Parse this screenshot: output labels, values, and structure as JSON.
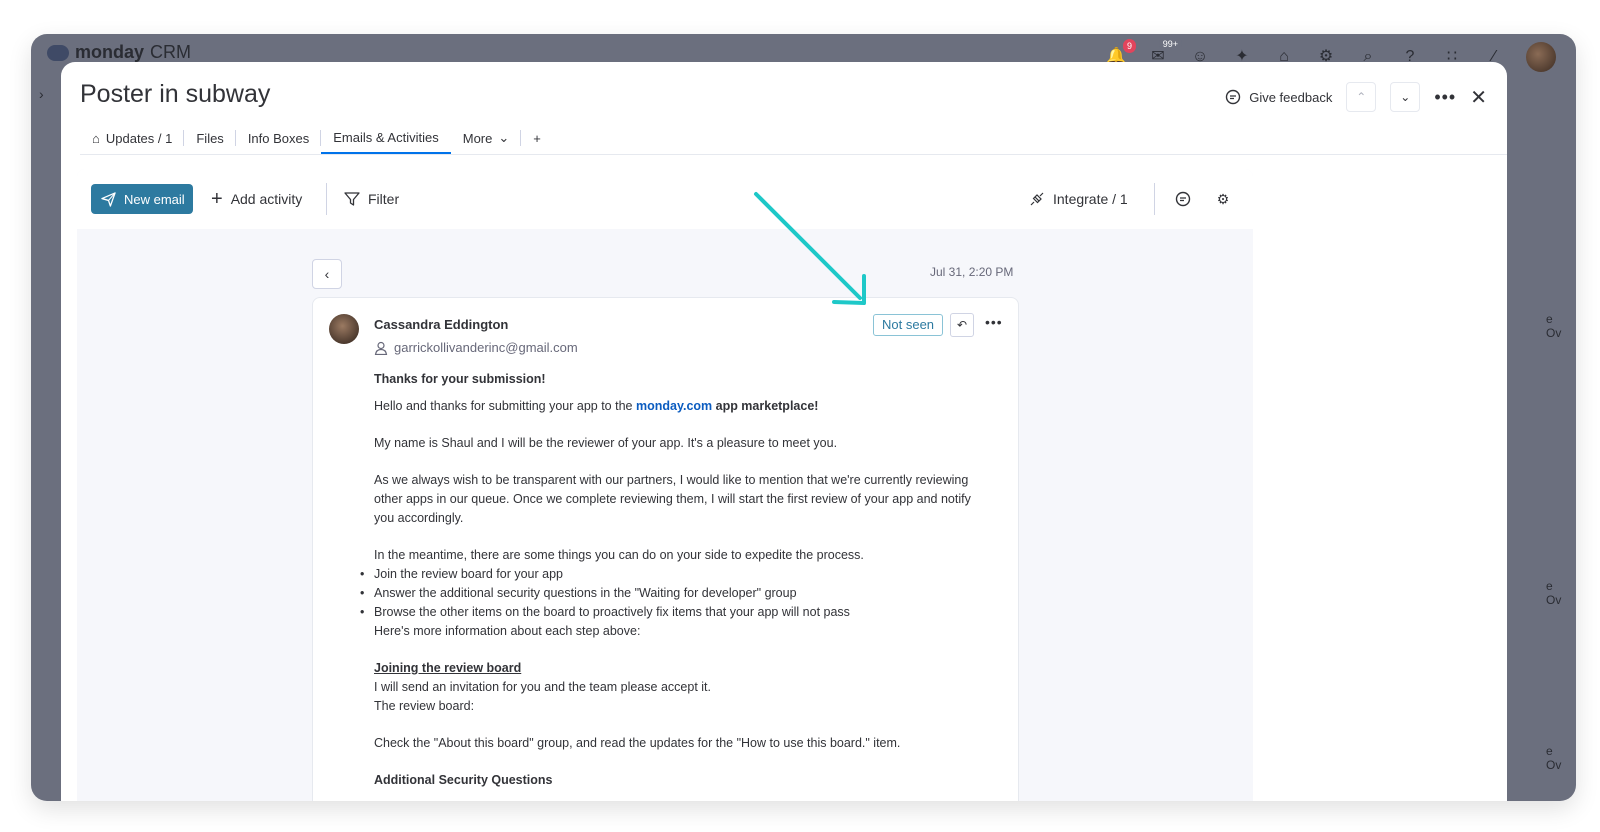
{
  "brand": {
    "name": "monday",
    "suffix": "CRM"
  },
  "topbar": {
    "notifications_badge": "9",
    "inbox_badge": "99+"
  },
  "right_strip": {
    "label_1": "e Ov",
    "label_2": "e Ov",
    "label_3": "e Ov"
  },
  "item": {
    "title": "Poster in subway"
  },
  "header": {
    "give_feedback": "Give feedback"
  },
  "tabs": {
    "updates": "Updates / 1",
    "files": "Files",
    "info_boxes": "Info Boxes",
    "emails_activities": "Emails & Activities",
    "more": "More",
    "add": "+"
  },
  "toolbar": {
    "new_email": "New email",
    "add_activity": "Add activity",
    "filter": "Filter",
    "integrate": "Integrate / 1"
  },
  "email": {
    "date": "Jul 31, 2:20 PM",
    "sender_name": "Cassandra Eddington",
    "sender_email": "garrickollivanderinc@gmail.com",
    "status": "Not seen",
    "subject": "Thanks for your submission!",
    "greeting_start": "Hello and thanks for submitting your app to the ",
    "greeting_link": "monday.com",
    "greeting_end": " app marketplace!",
    "intro": "My name is Shaul and I will be the reviewer of your app. It's a pleasure to meet you.",
    "transparency": "As we always wish to be transparent with our partners, I would like to mention that we're currently reviewing other apps in our queue. Once we complete reviewing them, I will start the first review of your app and notify you accordingly.",
    "meantime": "In the meantime, there are some things you can do on your side to expedite the process.",
    "bullets": [
      "Join the review board for your app",
      "Answer the additional security questions in the \"Waiting for developer\" group",
      "Browse the other items on the board to proactively fix items that your app will not pass"
    ],
    "more_info": "Here's more information about each step above:",
    "section_title": "Joining the review board",
    "invite": "I will send an invitation for you and the team please accept it.",
    "review_board": "The review board:",
    "check": "Check the \"About this board\" group, and read the updates for the \"How to use this board.\" item.",
    "next_section": "Additional Security Questions"
  },
  "colors": {
    "accent": "#2d7aa0",
    "annotation_arrow": "#1ec8c8",
    "link": "#0b5cc0"
  }
}
